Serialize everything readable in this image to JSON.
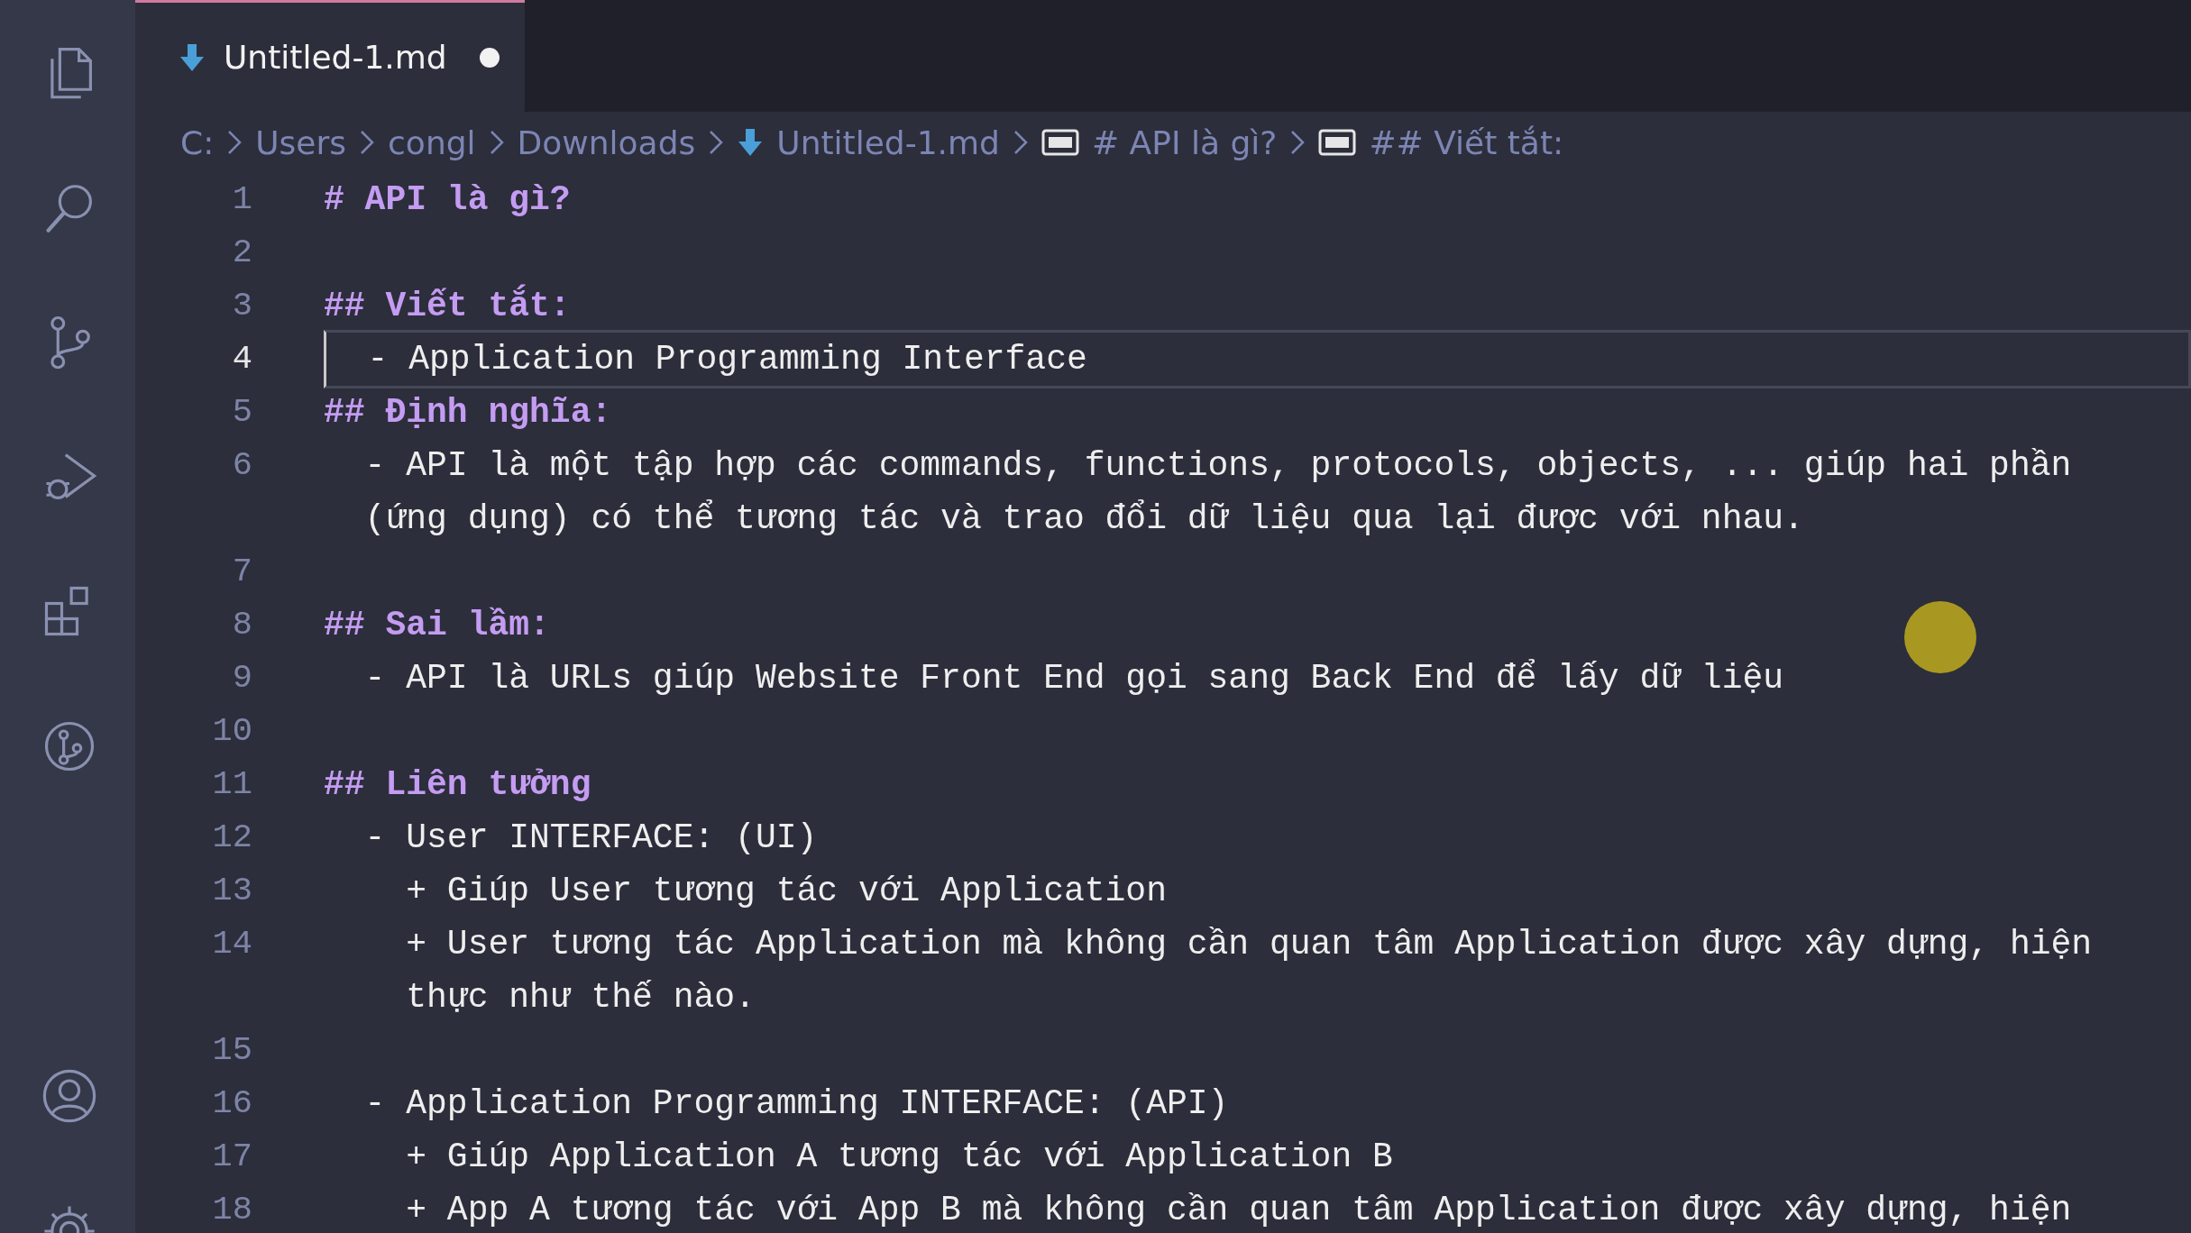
{
  "activity_bar": [
    {
      "kind": "files",
      "selected": false
    },
    {
      "kind": "search",
      "selected": false
    },
    {
      "kind": "source-control",
      "selected": false
    },
    {
      "kind": "run",
      "selected": false
    },
    {
      "kind": "extensions",
      "selected": false
    },
    {
      "kind": "graph",
      "selected": false
    }
  ],
  "activity_bottom": [
    {
      "kind": "account"
    },
    {
      "kind": "settings"
    }
  ],
  "tabs": [
    {
      "label": "Untitled-1.md",
      "selected": true,
      "modified": true
    }
  ],
  "breadcrumb": [
    {
      "kind": "folder",
      "label": "C:"
    },
    {
      "kind": "folder",
      "label": "Users"
    },
    {
      "kind": "folder",
      "label": "congl"
    },
    {
      "kind": "folder",
      "label": "Downloads"
    },
    {
      "kind": "file",
      "label": "Untitled-1.md"
    },
    {
      "kind": "symbol",
      "label": "# API là gì?"
    },
    {
      "kind": "symbol",
      "label": "## Viết tắt:"
    }
  ],
  "lines": [
    {
      "number": "1",
      "kind": "heading",
      "current": false,
      "rows": [
        "# API là gì?"
      ]
    },
    {
      "number": "2",
      "kind": "text",
      "current": false
    },
    {
      "number": "3",
      "kind": "heading",
      "current": false,
      "rows": [
        "## Viết tắt:"
      ]
    },
    {
      "number": "4",
      "kind": "text",
      "current": true,
      "rows": [
        "  - Application Programming Interface"
      ]
    },
    {
      "number": "5",
      "kind": "heading",
      "current": false,
      "rows": [
        "## Định nghĩa:"
      ]
    },
    {
      "number": "6",
      "kind": "text",
      "current": false,
      "rows": [
        "  - API là một tập hợp các commands, functions, protocols, objects, ... giúp hai phần",
        "  (ứng dụng) có thể tương tác và trao đổi dữ liệu qua lại được với nhau."
      ]
    },
    {
      "number": "7",
      "kind": "text",
      "current": false
    },
    {
      "number": "8",
      "kind": "heading",
      "current": false,
      "rows": [
        "## Sai lầm:"
      ]
    },
    {
      "number": "9",
      "kind": "text",
      "current": false,
      "rows": [
        "  - API là URLs giúp Website Front End gọi sang Back End để lấy dữ liệu"
      ]
    },
    {
      "number": "10",
      "kind": "text",
      "current": false
    },
    {
      "number": "11",
      "kind": "heading",
      "current": false,
      "rows": [
        "## Liên tưởng"
      ]
    },
    {
      "number": "12",
      "kind": "text",
      "current": false,
      "rows": [
        "  - User INTERFACE: (UI)"
      ]
    },
    {
      "number": "13",
      "kind": "text",
      "current": false,
      "rows": [
        "    + Giúp User tương tác với Application"
      ]
    },
    {
      "number": "14",
      "kind": "text",
      "current": false,
      "rows": [
        "    + User tương tác Application mà không cần quan tâm Application được xây dựng, hiện",
        "    thực như thế nào."
      ]
    },
    {
      "number": "15",
      "kind": "text",
      "current": false
    },
    {
      "number": "16",
      "kind": "text",
      "current": false,
      "rows": [
        "  - Application Programming INTERFACE: (API)"
      ]
    },
    {
      "number": "17",
      "kind": "text",
      "current": false,
      "rows": [
        "    + Giúp Application A tương tác với Application B"
      ]
    },
    {
      "number": "18",
      "kind": "text",
      "current": false,
      "rows": [
        "    + App A tương tác với App B mà không cần quan tâm Application được xây dựng, hiện"
      ]
    }
  ]
}
